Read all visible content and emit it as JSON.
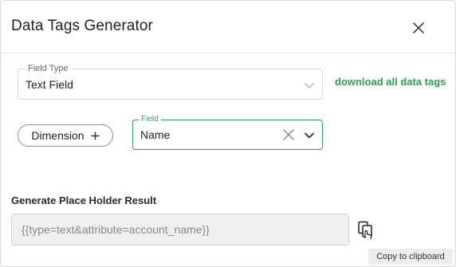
{
  "dialog": {
    "title": "Data Tags Generator"
  },
  "field_type": {
    "label": "Field Type",
    "value": "Text Field"
  },
  "download_link": "download all data tags",
  "dimension_button": {
    "label": "Dimension",
    "icon": "plus-icon"
  },
  "field": {
    "label": "Field",
    "value": "Name",
    "accent_color": "#2e9e56"
  },
  "result": {
    "label": "Generate Place Holder Result",
    "value": "{{type=text&attribute=account_name}}"
  },
  "copy": {
    "icon": "copy-icon",
    "tooltip": "Copy to clipboard"
  },
  "colors": {
    "accent": "#2e9e56",
    "input_bg": "#efefef",
    "border": "#d6d6d6"
  }
}
